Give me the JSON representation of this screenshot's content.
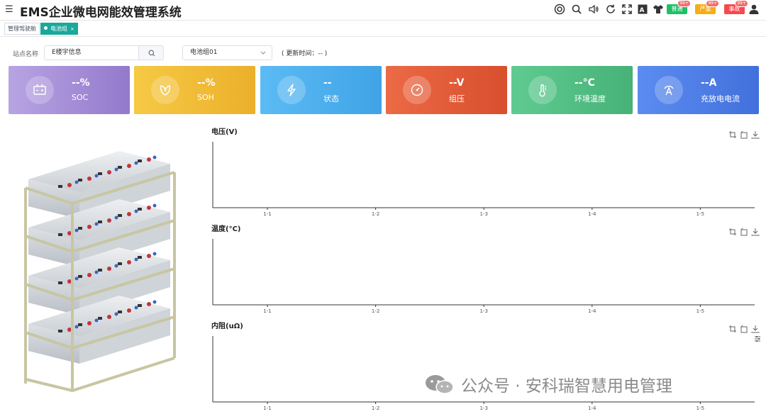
{
  "app": {
    "title": "EMS企业微电网能效管理系统"
  },
  "header": {
    "icons": [
      "lifebuoy-icon",
      "search-icon",
      "volume-icon",
      "refresh-icon",
      "fullscreen-icon",
      "font-size-icon",
      "tshirt-icon"
    ],
    "alerts": [
      {
        "label": "普通",
        "badge": "99+",
        "color": "#1fc068"
      },
      {
        "label": "严重",
        "badge": "99+",
        "color": "#f7ad14"
      },
      {
        "label": "事故",
        "badge": "99+",
        "color": "#f4494f"
      }
    ]
  },
  "tabs": [
    {
      "label": "管理驾驶舱",
      "active": false
    },
    {
      "label": "电池组",
      "active": true,
      "close": "×"
    }
  ],
  "filters": {
    "site_label": "站点名称",
    "site_value": "E楼宇信息",
    "group_value": "电池组01",
    "update_time": "( 更新时间：-- )"
  },
  "cards": [
    {
      "value": "--%",
      "label": "SOC",
      "icon": "battery-icon",
      "color": "#a58fd6"
    },
    {
      "value": "--%",
      "label": "SOH",
      "icon": "leaf-icon",
      "color": "#f2bd35"
    },
    {
      "value": "--",
      "label": "状态",
      "icon": "lightning-icon",
      "color": "#4cb0ee"
    },
    {
      "value": "--V",
      "label": "组压",
      "icon": "gauge-icon",
      "color": "#e35e3a"
    },
    {
      "value": "--°C",
      "label": "环境温度",
      "icon": "thermometer-icon",
      "color": "#55c088"
    },
    {
      "value": "--A",
      "label": "充放电电流",
      "icon": "current-icon",
      "color": "#4f7fe6"
    }
  ],
  "charts": [
    {
      "title": "电压(V)"
    },
    {
      "title": "温度(°C)"
    },
    {
      "title": "内阻(uΩ)"
    }
  ],
  "chart_data": [
    {
      "type": "line",
      "title": "电压(V)",
      "categories": [
        "1-1",
        "1-2",
        "1-3",
        "1-4",
        "1-5"
      ],
      "series": []
    },
    {
      "type": "line",
      "title": "温度(°C)",
      "categories": [
        "1-1",
        "1-2",
        "1-3",
        "1-4",
        "1-5"
      ],
      "series": []
    },
    {
      "type": "line",
      "title": "内阻(uΩ)",
      "categories": [
        "1-1",
        "1-2",
        "1-3",
        "1-4",
        "1-5"
      ],
      "series": []
    }
  ],
  "watermark": {
    "text": "公众号 · 安科瑞智慧用电管理"
  }
}
